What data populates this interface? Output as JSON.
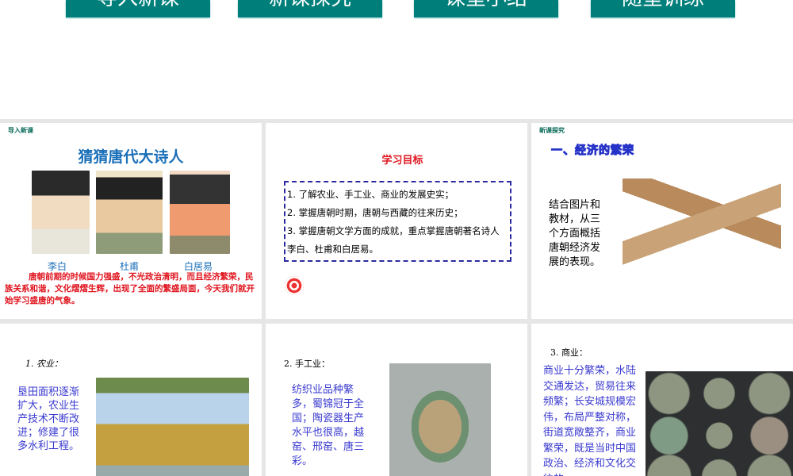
{
  "nav": {
    "buttons": [
      "导入新课",
      "新课探究",
      "课堂小结",
      "随堂训练"
    ]
  },
  "slide1": {
    "tag": "导入新课",
    "title": "猜猜唐代大诗人",
    "poets": [
      "李白",
      "杜甫",
      "白居易"
    ],
    "text": "唐朝前期的时候国力强盛，不光政治清明，而且经济繁荣，民族关系和谐，文化熠熠生辉，出现了全面的繁盛局面，今天我们就开始学习盛唐的气象。"
  },
  "slide2": {
    "title": "学习目标",
    "goals": [
      "1. 了解农业、手工业、商业的发展史实；",
      "2. 掌握唐朝时期，唐朝与西藏的往来历史；",
      "3. 掌握唐朝文学方面的成就，重点掌握唐朝著名诗人李白、杜甫和白居易。"
    ]
  },
  "slide3": {
    "tag": "新课探究",
    "title": "一、经济的繁荣",
    "text": "结合图片和教材，从三个方面概括唐朝经济发展的表现。"
  },
  "slide4": {
    "heading": "1. 农业：",
    "text": "垦田面积逐渐扩大，农业生产技术不断改进；修建了很多水利工程。"
  },
  "slide5": {
    "heading": "2. 手工业：",
    "text": "纺织业品种繁多，蜀锦冠于全国；陶瓷器生产水平也很高，越窑、邢窑、唐三彩。"
  },
  "slide6": {
    "heading": "3. 商业：",
    "text": "商业十分繁荣，水陆交通发达，贸易往来频繁；长安城规模宏伟，布局严整对称，街道宽敞整齐，商业繁荣，既是当时中国政治、经济和文化交往的"
  }
}
